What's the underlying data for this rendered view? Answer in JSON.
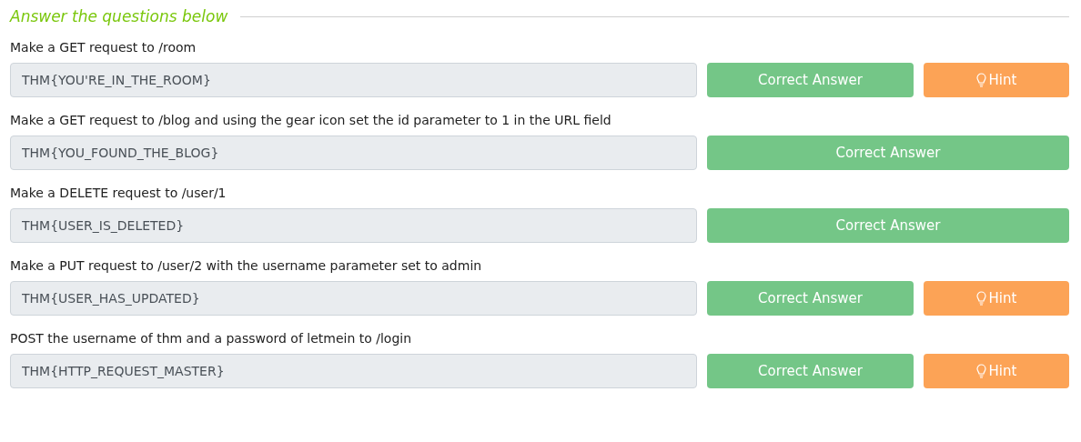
{
  "heading": "Answer the questions below",
  "questions": [
    {
      "prompt": "Make a GET request to /room",
      "answer": "THM{YOU'RE_IN_THE_ROOM}",
      "submit": "Correct Answer",
      "hint": "Hint"
    },
    {
      "prompt": "Make a GET request to /blog and using the gear icon set the id parameter to 1 in the URL field",
      "answer": "THM{YOU_FOUND_THE_BLOG}",
      "submit": "Correct Answer"
    },
    {
      "prompt": "Make a DELETE request to /user/1",
      "answer": "THM{USER_IS_DELETED}",
      "submit": "Correct Answer"
    },
    {
      "prompt": "Make a PUT request to /user/2 with the username parameter set to admin",
      "answer": "THM{USER_HAS_UPDATED}",
      "submit": "Correct Answer",
      "hint": "Hint"
    },
    {
      "prompt": "POST the username of thm and a password of letmein to /login",
      "answer": "THM{HTTP_REQUEST_MASTER}",
      "submit": "Correct Answer",
      "hint": "Hint"
    }
  ]
}
